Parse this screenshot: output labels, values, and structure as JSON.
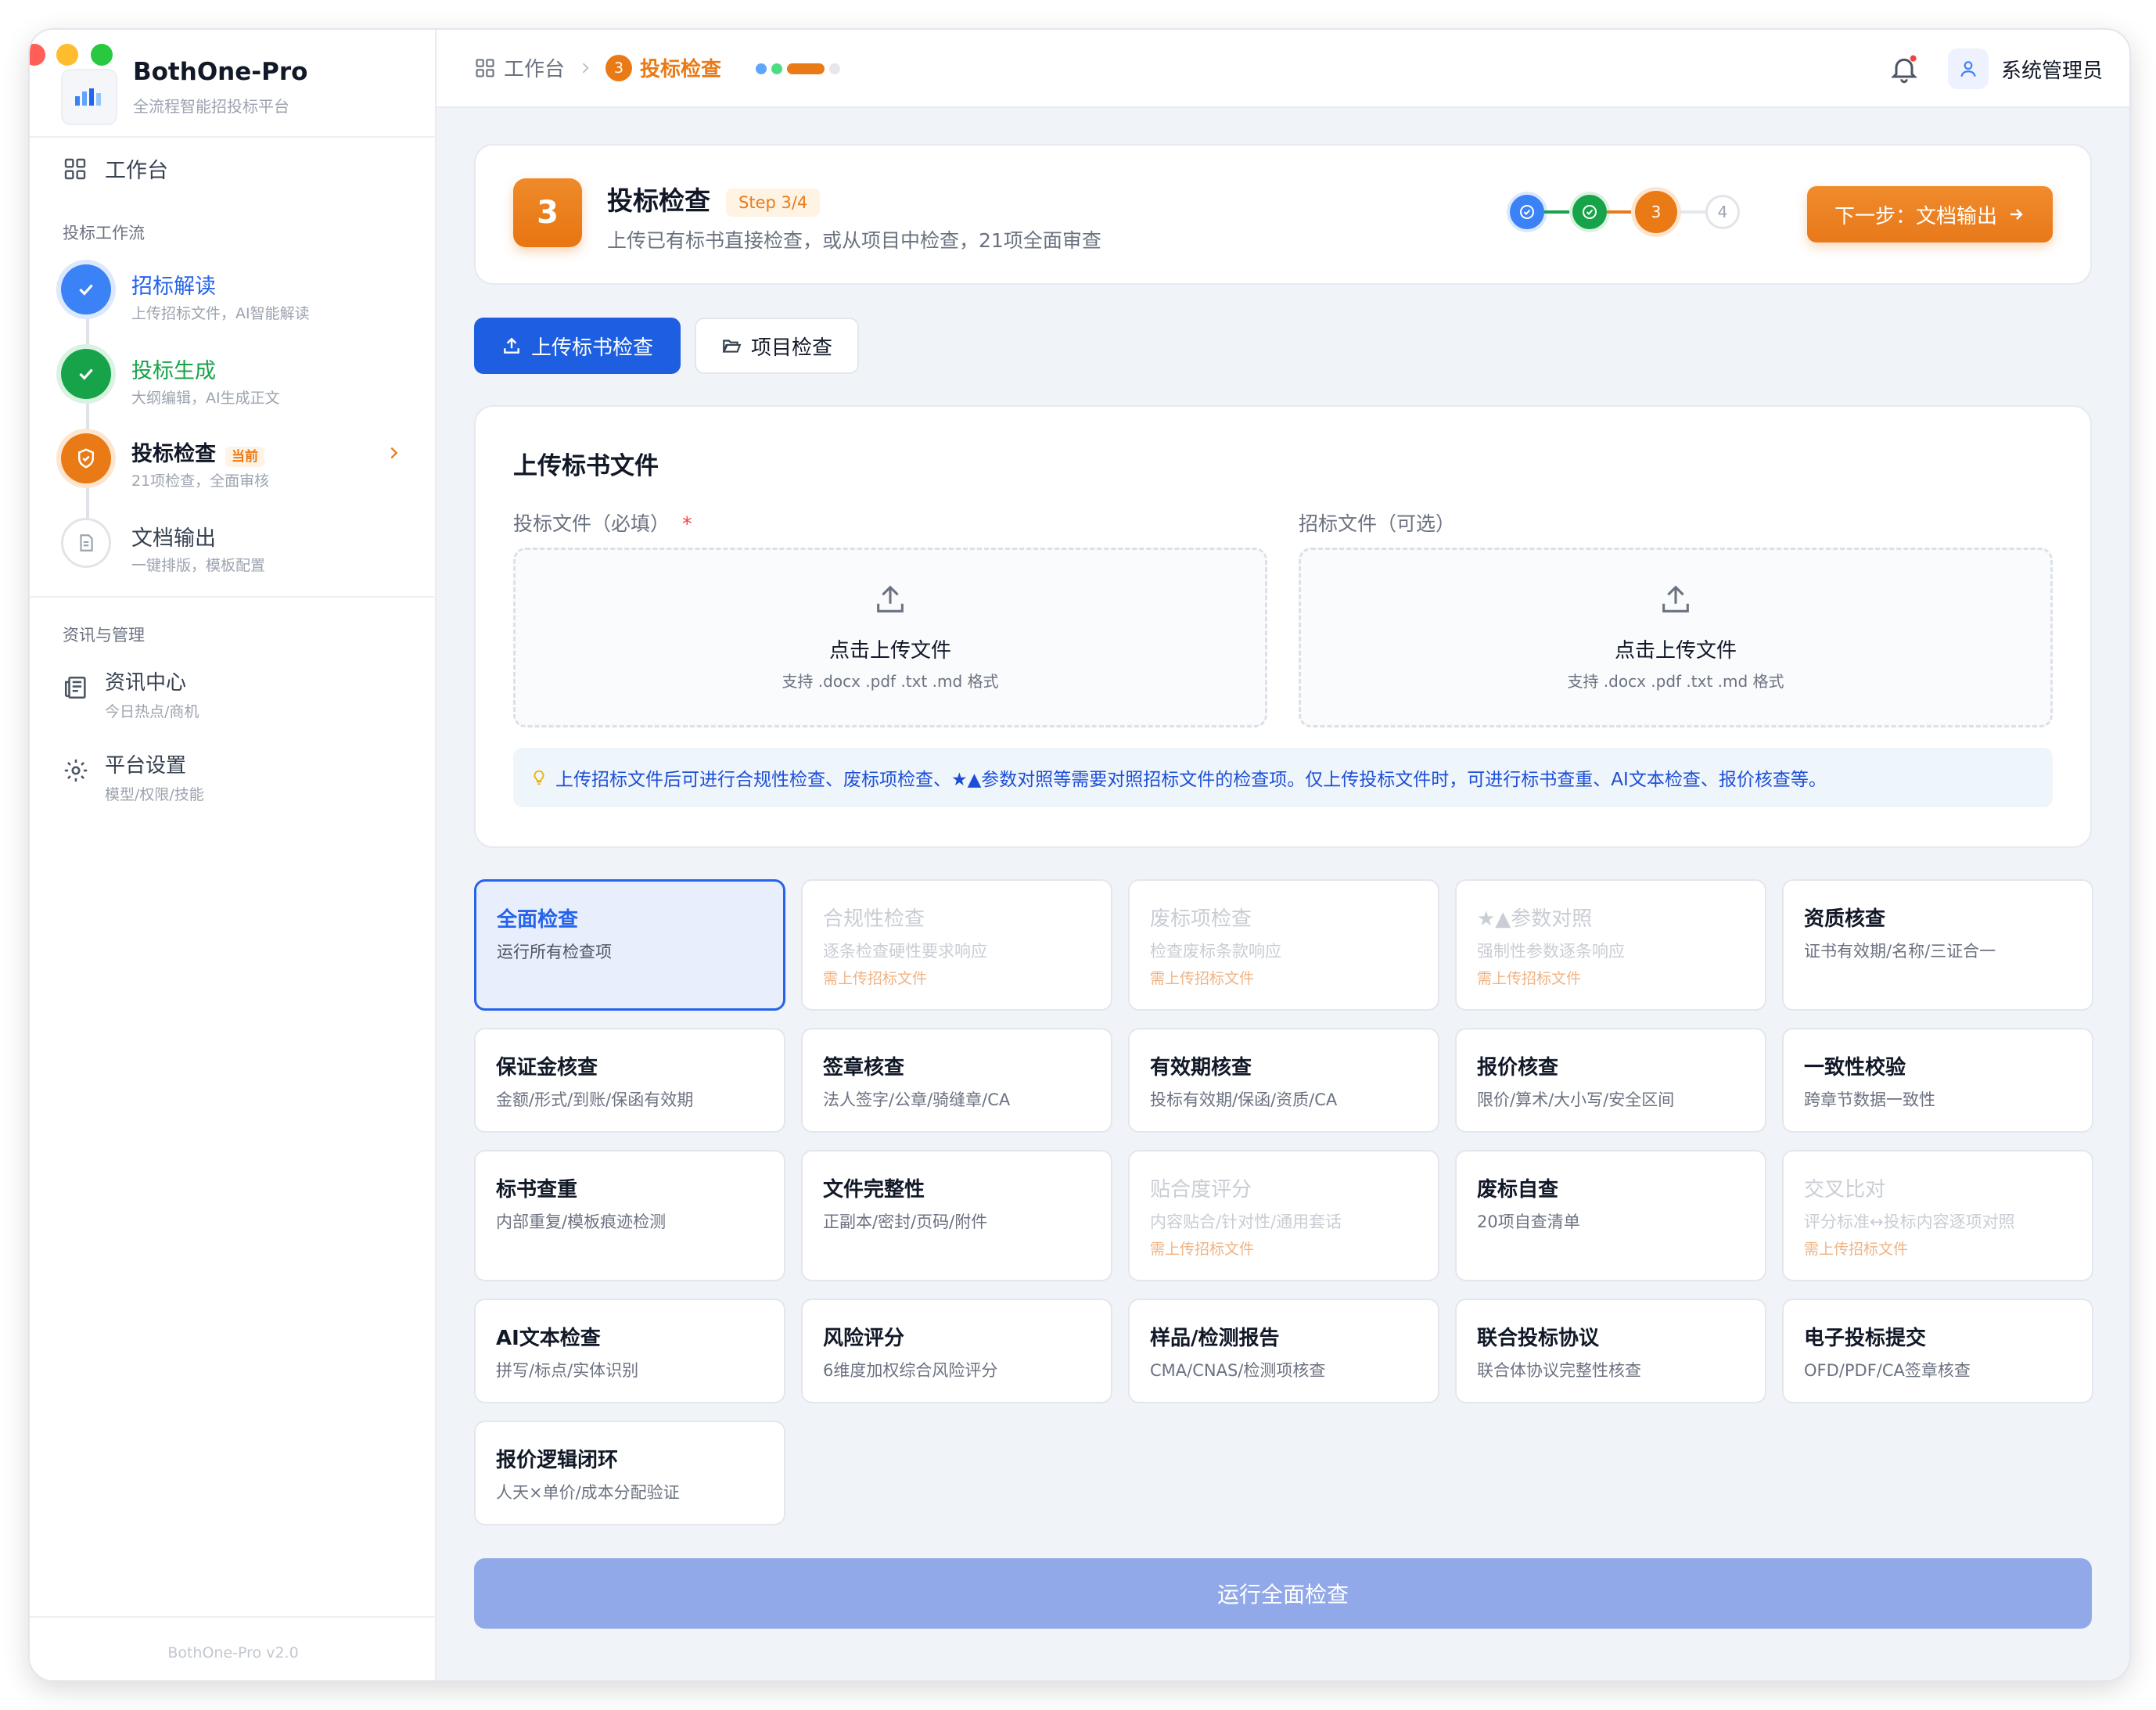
{
  "app": {
    "name": "BothOne-Pro",
    "subtitle": "全流程智能招投标平台",
    "version": "BothOne-Pro v2.0"
  },
  "sidebar": {
    "home": "工作台",
    "workflow_title": "投标工作流",
    "workflow": [
      {
        "label": "招标解读",
        "desc": "上传招标文件，AI智能解读",
        "status": "done"
      },
      {
        "label": "投标生成",
        "desc": "大纲编辑，AI生成正文",
        "status": "done"
      },
      {
        "label": "投标检查",
        "desc": "21项检查，全面审核",
        "status": "current",
        "badge": "当前"
      },
      {
        "label": "文档输出",
        "desc": "一键排版，模板配置",
        "status": "todo"
      }
    ],
    "mgmt_title": "资讯与管理",
    "mgmt": [
      {
        "label": "资讯中心",
        "desc": "今日热点/商机"
      },
      {
        "label": "平台设置",
        "desc": "模型/权限/技能"
      }
    ]
  },
  "topbar": {
    "crumb_home": "工作台",
    "crumb_num": "3",
    "crumb_current": "投标检查",
    "user": "系统管理员"
  },
  "step": {
    "num": "3",
    "title": "投标检查",
    "badge": "Step 3/4",
    "desc": "上传已有标书直接检查，或从项目中检查，21项全面审查",
    "progress": [
      "done",
      "done",
      "3",
      "4"
    ],
    "next": "下一步：文档输出"
  },
  "tabs": {
    "upload": "上传标书检查",
    "project": "项目检查"
  },
  "upload": {
    "title": "上传标书文件",
    "bid_label": "投标文件（必填）",
    "required_mark": "*",
    "tender_label": "招标文件（可选）",
    "click": "点击上传文件",
    "formats": "支持 .docx .pdf .txt .md 格式",
    "tip": "上传招标文件后可进行合规性检查、废标项检查、★▲参数对照等需要对照招标文件的检查项。仅上传投标文件时，可进行标书查重、AI文本检查、报价核查等。"
  },
  "checks": [
    {
      "title": "全面检查",
      "desc": "运行所有检查项",
      "state": "selected"
    },
    {
      "title": "合规性检查",
      "desc": "逐条检查硬性要求响应",
      "state": "disabled",
      "warn": "需上传招标文件"
    },
    {
      "title": "废标项检查",
      "desc": "检查废标条款响应",
      "state": "disabled",
      "warn": "需上传招标文件"
    },
    {
      "title": "★▲参数对照",
      "desc": "强制性参数逐条响应",
      "state": "disabled",
      "warn": "需上传招标文件"
    },
    {
      "title": "资质核查",
      "desc": "证书有效期/名称/三证合一",
      "state": "normal"
    },
    {
      "title": "保证金核查",
      "desc": "金额/形式/到账/保函有效期",
      "state": "normal"
    },
    {
      "title": "签章核查",
      "desc": "法人签字/公章/骑缝章/CA",
      "state": "normal"
    },
    {
      "title": "有效期核查",
      "desc": "投标有效期/保函/资质/CA",
      "state": "normal"
    },
    {
      "title": "报价核查",
      "desc": "限价/算术/大小写/安全区间",
      "state": "normal"
    },
    {
      "title": "一致性校验",
      "desc": "跨章节数据一致性",
      "state": "normal"
    },
    {
      "title": "标书查重",
      "desc": "内部重复/模板痕迹检测",
      "state": "normal"
    },
    {
      "title": "文件完整性",
      "desc": "正副本/密封/页码/附件",
      "state": "normal"
    },
    {
      "title": "贴合度评分",
      "desc": "内容贴合/针对性/通用套话",
      "state": "disabled",
      "warn": "需上传招标文件"
    },
    {
      "title": "废标自查",
      "desc": "20项自查清单",
      "state": "normal"
    },
    {
      "title": "交叉比对",
      "desc": "评分标准↔投标内容逐项对照",
      "state": "disabled",
      "warn": "需上传招标文件"
    },
    {
      "title": "AI文本检查",
      "desc": "拼写/标点/实体识别",
      "state": "normal"
    },
    {
      "title": "风险评分",
      "desc": "6维度加权综合风险评分",
      "state": "normal"
    },
    {
      "title": "样品/检测报告",
      "desc": "CMA/CNAS/检测项核查",
      "state": "normal"
    },
    {
      "title": "联合投标协议",
      "desc": "联合体协议完整性核查",
      "state": "normal"
    },
    {
      "title": "电子投标提交",
      "desc": "OFD/PDF/CA签章核查",
      "state": "normal"
    },
    {
      "title": "报价逻辑闭环",
      "desc": "人天×单价/成本分配验证",
      "state": "normal"
    }
  ],
  "run_button": "运行全面检查",
  "colors": {
    "primary": "#2563eb",
    "accent": "#ea7a16",
    "success": "#16a34a",
    "run_disabled": "#92a9e9"
  }
}
